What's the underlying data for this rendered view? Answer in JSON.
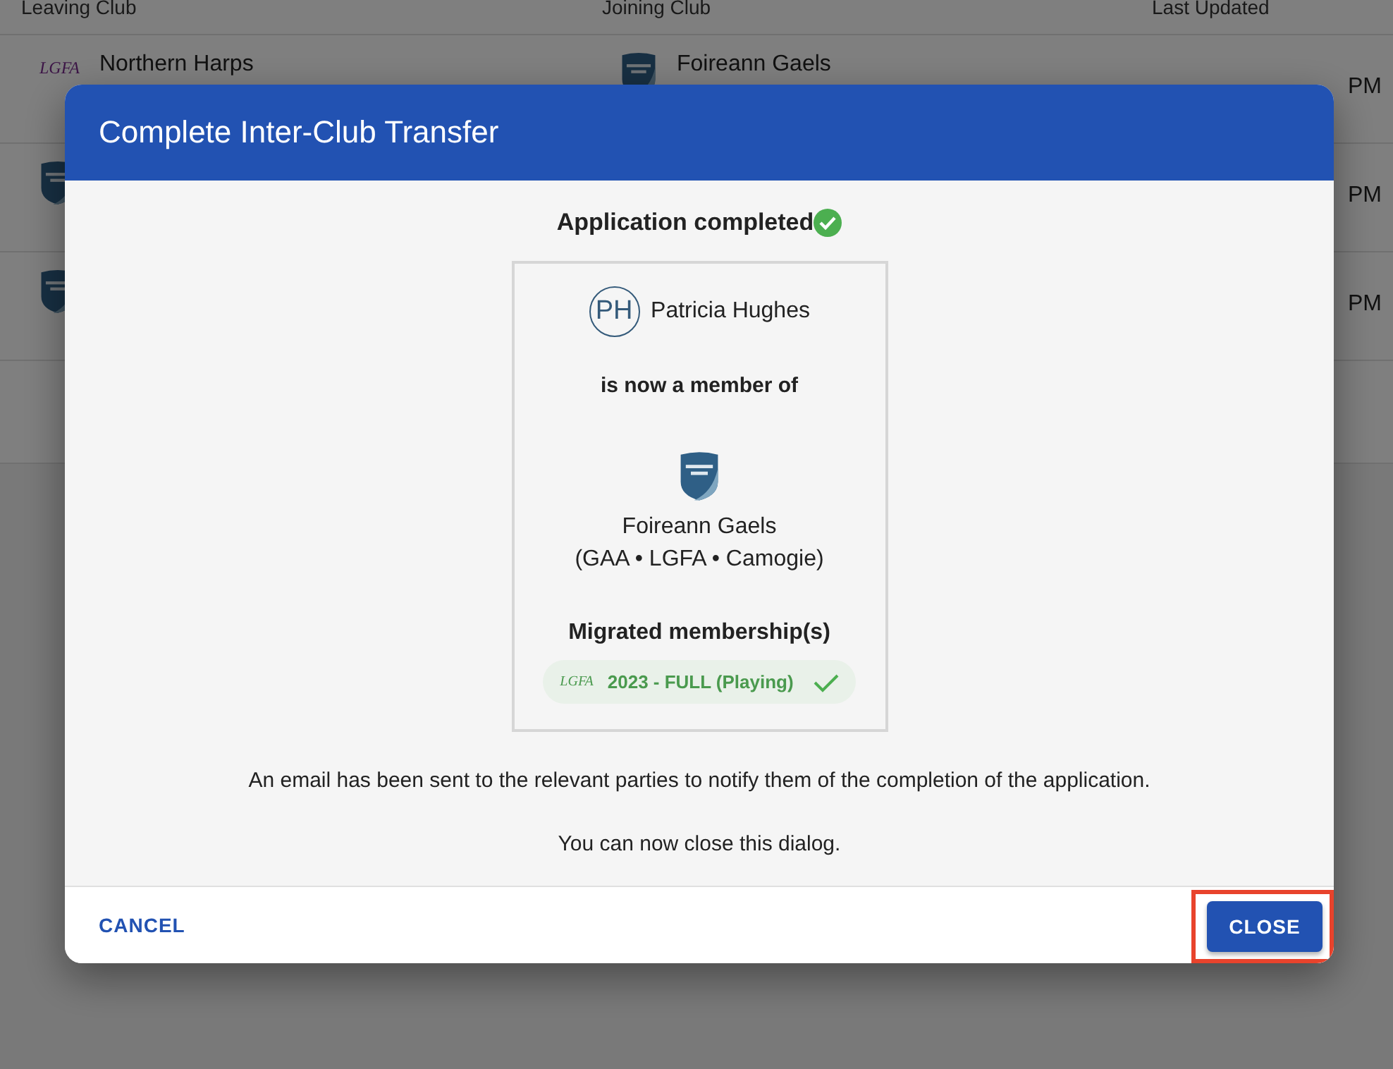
{
  "background_table": {
    "columns": [
      "Leaving Club",
      "Joining Club",
      "Last Updated"
    ],
    "rows": [
      {
        "leaving_logo": {
          "kind": "lgfa",
          "text": "LGFA"
        },
        "leaving_club": "Northern Harps",
        "joining_logo": {
          "kind": "shield"
        },
        "joining_club": "Foireann Gaels",
        "last_updated": "PM"
      },
      {
        "leaving_logo": {
          "kind": "shield"
        },
        "last_updated": "PM"
      },
      {
        "leaving_logo": {
          "kind": "shield"
        },
        "last_updated": "PM"
      }
    ]
  },
  "dialog": {
    "title": "Complete Inter-Club Transfer",
    "status": "Application completed",
    "member": {
      "initials": "PH",
      "name": "Patricia Hughes"
    },
    "member_of_label": "is now a member of",
    "club": {
      "name": "Foireann Gaels",
      "codes": "(GAA • LGFA • Camogie)"
    },
    "migrated_heading": "Migrated membership(s)",
    "memberships": [
      {
        "association": "LGFA",
        "label": "2023 - FULL (Playing)",
        "confirmed": true
      }
    ],
    "message": "An email has been sent to the relevant parties to notify them of the completion of the application.",
    "note": "You can now close this dialog.",
    "actions": {
      "cancel": {
        "label": "CANCEL"
      },
      "close": {
        "label": "CLOSE",
        "highlighted": true
      }
    }
  }
}
